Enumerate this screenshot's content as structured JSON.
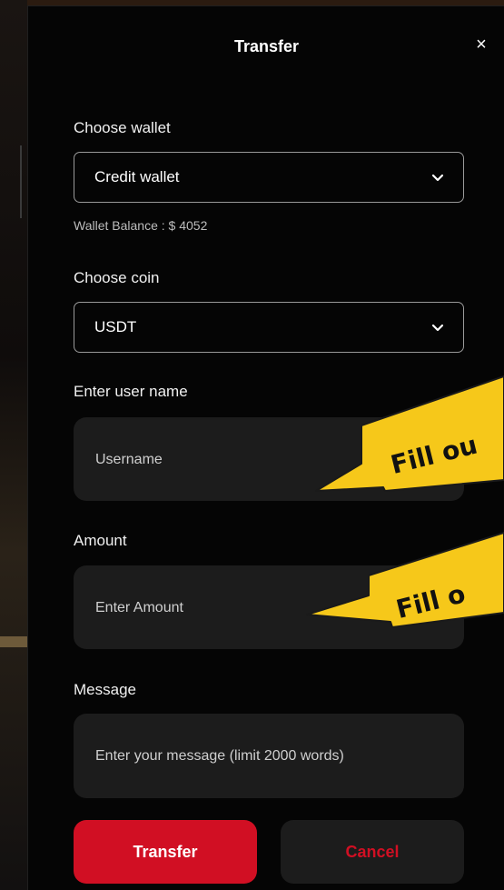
{
  "modal": {
    "title": "Transfer",
    "close_label": "×"
  },
  "wallet": {
    "label": "Choose wallet",
    "selected": "Credit wallet",
    "balance_text": "Wallet Balance : $ 4052"
  },
  "coin": {
    "label": "Choose coin",
    "selected": "USDT"
  },
  "username": {
    "label": "Enter user name",
    "placeholder": "Username"
  },
  "amount": {
    "label": "Amount",
    "placeholder": "Enter Amount"
  },
  "message": {
    "label": "Message",
    "placeholder": "Enter your message (limit 2000 words)"
  },
  "buttons": {
    "transfer": "Transfer",
    "cancel": "Cancel"
  },
  "callouts": {
    "username_hint": "Fill ou",
    "amount_hint": "Fill o"
  },
  "colors": {
    "accent": "#d10f23",
    "callout": "#f6c81a",
    "background": "#050505",
    "input_bg": "#1c1c1c"
  }
}
